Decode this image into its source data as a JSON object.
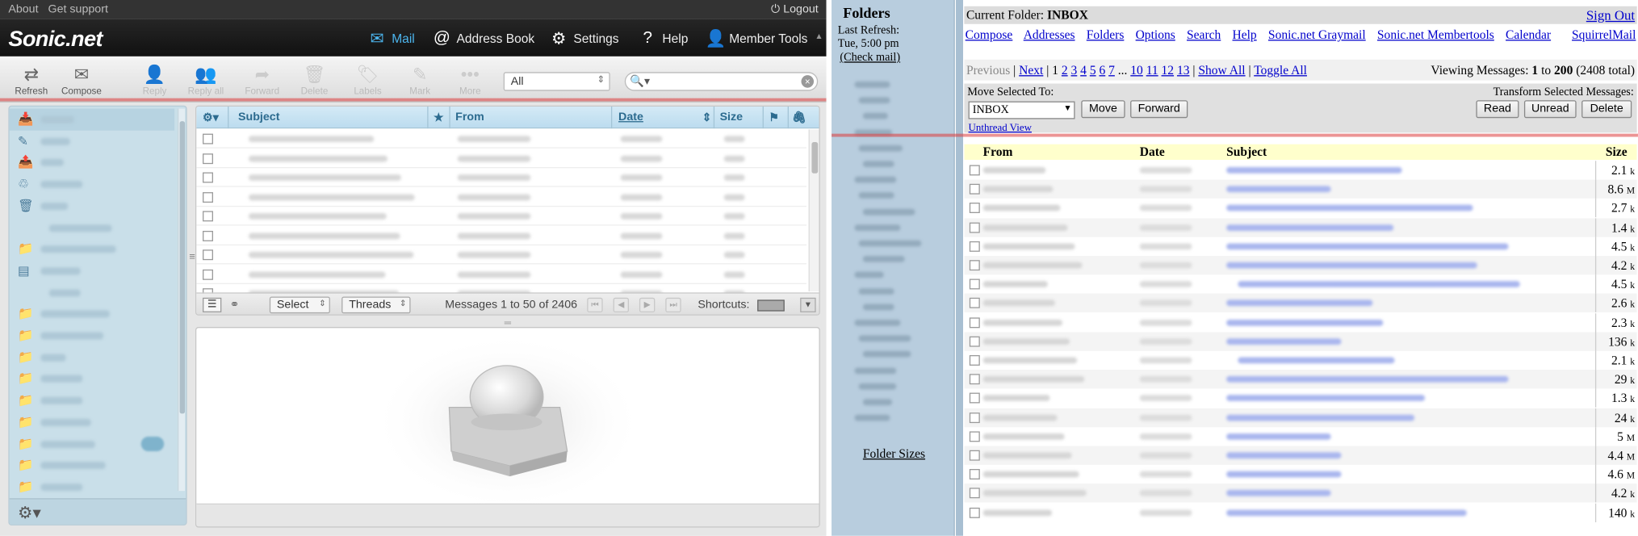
{
  "roundcube": {
    "topbar": {
      "about": "About",
      "support": "Get support",
      "logout": "Logout"
    },
    "brand": "Sonic.net",
    "nav": [
      {
        "label": "Mail",
        "icon": "envelope-icon",
        "active": true
      },
      {
        "label": "Address Book",
        "icon": "at-icon",
        "active": false
      },
      {
        "label": "Settings",
        "icon": "gear-icon",
        "active": false
      },
      {
        "label": "Help",
        "icon": "question-icon",
        "active": false
      },
      {
        "label": "Member Tools",
        "icon": "person-icon",
        "active": false
      }
    ],
    "toolbar": {
      "refresh": "Refresh",
      "compose": "Compose",
      "reply": "Reply",
      "reply_all": "Reply all",
      "forward": "Forward",
      "delete": "Delete",
      "labels": "Labels",
      "mark": "Mark",
      "more": "More"
    },
    "filter": {
      "selected": "All"
    },
    "list": {
      "columns": {
        "subject": "Subject",
        "from": "From",
        "date": "Date",
        "size": "Size"
      },
      "footer": {
        "select": "Select",
        "threads": "Threads",
        "count": "Messages 1 to 50 of 2406",
        "shortcuts": "Shortcuts:"
      }
    }
  },
  "squirrelmail": {
    "sidebar": {
      "title": "Folders",
      "last_refresh_label": "Last Refresh:",
      "last_refresh_time": "Tue, 5:00 pm",
      "check_mail": "(Check mail)",
      "folder_sizes": "Folder Sizes"
    },
    "current_folder_label": "Current Folder:",
    "current_folder": "INBOX",
    "sign_out": "Sign Out",
    "menu": [
      "Compose",
      "Addresses",
      "Folders",
      "Options",
      "Search",
      "Help",
      "Sonic.net Graymail",
      "Sonic.net Membertools",
      "Calendar"
    ],
    "brand_link": "SquirrelMail",
    "pager": {
      "previous": "Previous",
      "next": "Next",
      "current_page": "1",
      "pages": [
        "2",
        "3",
        "4",
        "5",
        "6",
        "7"
      ],
      "ellipsis": "...",
      "pages_tail": [
        "10",
        "11",
        "12",
        "13"
      ],
      "show_all": "Show All",
      "toggle_all": "Toggle All",
      "viewing_label": "Viewing Messages:",
      "viewing_from": "1",
      "viewing_to_label": "to",
      "viewing_to": "200",
      "viewing_total": "(2408 total)"
    },
    "move": {
      "label": "Move Selected To:",
      "target": "INBOX",
      "move_btn": "Move",
      "forward_btn": "Forward",
      "transform_label": "Transform Selected Messages:",
      "read_btn": "Read",
      "unread_btn": "Unread",
      "delete_btn": "Delete",
      "unthread": "Unthread View"
    },
    "table_headers": {
      "from": "From",
      "date": "Date",
      "subject": "Subject",
      "size": "Size"
    },
    "sizes": [
      {
        "v": "2.1",
        "u": "k"
      },
      {
        "v": "8.6",
        "u": "M"
      },
      {
        "v": "2.7",
        "u": "k"
      },
      {
        "v": "1.4",
        "u": "k"
      },
      {
        "v": "4.5",
        "u": "k"
      },
      {
        "v": "4.2",
        "u": "k"
      },
      {
        "v": "4.5",
        "u": "k"
      },
      {
        "v": "2.6",
        "u": "k"
      },
      {
        "v": "2.3",
        "u": "k"
      },
      {
        "v": "136",
        "u": "k"
      },
      {
        "v": "2.1",
        "u": "k"
      },
      {
        "v": "29",
        "u": "k"
      },
      {
        "v": "1.3",
        "u": "k"
      },
      {
        "v": "24",
        "u": "k"
      },
      {
        "v": "5",
        "u": "M"
      },
      {
        "v": "4.4",
        "u": "M"
      },
      {
        "v": "4.6",
        "u": "M"
      },
      {
        "v": "4.2",
        "u": "k"
      },
      {
        "v": "140",
        "u": "k"
      }
    ]
  }
}
